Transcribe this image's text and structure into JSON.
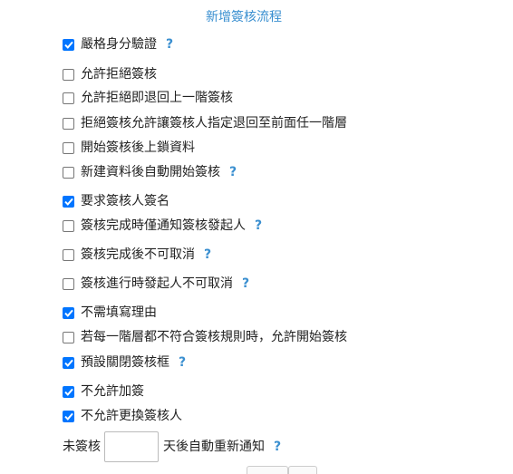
{
  "title": "新增簽核流程",
  "help_symbol": "?",
  "colors": {
    "accent": "#3a8fd0",
    "checkbox_on": "#0075ff"
  },
  "options": [
    {
      "label": "嚴格身分驗證",
      "checked": true,
      "help": true
    },
    {
      "label": "允許拒絕簽核",
      "checked": false,
      "help": false
    },
    {
      "label": "允許拒絕即退回上一階簽核",
      "checked": false,
      "help": false
    },
    {
      "label": "拒絕簽核允許讓簽核人指定退回至前面任一階層",
      "checked": false,
      "help": false
    },
    {
      "label": "開始簽核後上鎖資料",
      "checked": false,
      "help": false
    },
    {
      "label": "新建資料後自動開始簽核",
      "checked": false,
      "help": true
    },
    {
      "label": "要求簽核人簽名",
      "checked": true,
      "help": false
    },
    {
      "label": "簽核完成時僅通知簽核發起人",
      "checked": false,
      "help": true
    },
    {
      "label": "簽核完成後不可取消",
      "checked": false,
      "help": true
    },
    {
      "label": "簽核進行時發起人不可取消",
      "checked": false,
      "help": true
    },
    {
      "label": "不需填寫理由",
      "checked": true,
      "help": false
    },
    {
      "label": "若每一階層都不符合簽核規則時，允許開始簽核",
      "checked": false,
      "help": false
    },
    {
      "label": "預設關閉簽核框",
      "checked": true,
      "help": true
    },
    {
      "label": "不允許加簽",
      "checked": true,
      "help": false
    },
    {
      "label": "不允許更換簽核人",
      "checked": true,
      "help": false
    }
  ],
  "reminder": {
    "prefix": "未簽核",
    "value": "",
    "suffix": "天後自動重新通知",
    "help": true
  }
}
